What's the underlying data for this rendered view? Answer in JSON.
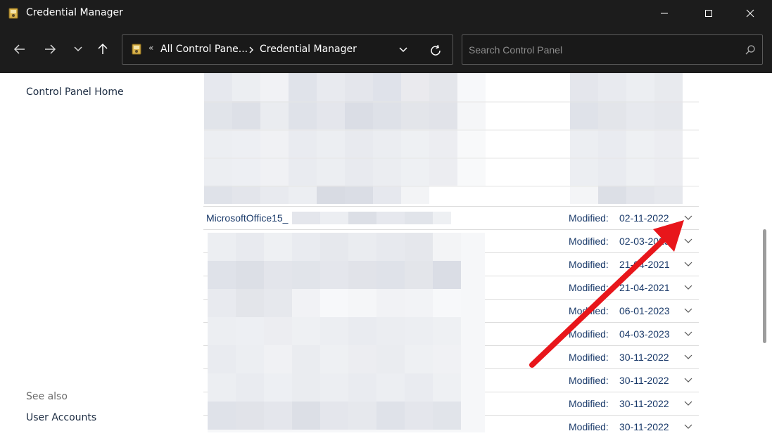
{
  "window": {
    "title": "Credential Manager",
    "minimize_icon": "minimize-icon",
    "maximize_icon": "maximize-icon",
    "close_icon": "close-icon"
  },
  "nav": {
    "back_icon": "arrow-left-icon",
    "forward_icon": "arrow-right-icon",
    "recent_icon": "chevron-down-icon",
    "up_icon": "arrow-up-icon"
  },
  "address": {
    "overflow_chevrons": "«",
    "crumb1": "All Control Pane...",
    "crumb2": "Credential Manager",
    "dropdown_icon": "chevron-down-icon",
    "refresh_icon": "refresh-icon"
  },
  "search": {
    "placeholder": "Search Control Panel",
    "value": "",
    "icon": "search-icon"
  },
  "sidebar": {
    "home_link": "Control Panel Home",
    "see_also": "See also",
    "links": [
      {
        "label": "User Accounts"
      }
    ]
  },
  "credentials": [
    {
      "name": "MicrosoftOffice15_",
      "modified_label": "Modified:",
      "date": "02-11-2022"
    },
    {
      "name": "",
      "modified_label": "Modified:",
      "date": "02-03-2023"
    },
    {
      "name": "",
      "modified_label": "Modified:",
      "date": "21-04-2021"
    },
    {
      "name": "",
      "modified_label": "Modified:",
      "date": "21-04-2021"
    },
    {
      "name": "",
      "modified_label": "Modified:",
      "date": "06-01-2023"
    },
    {
      "name": "",
      "modified_label": "Modified:",
      "date": "04-03-2023"
    },
    {
      "name": "",
      "modified_label": "Modified:",
      "date": "30-11-2022"
    },
    {
      "name": "",
      "modified_label": "Modified:",
      "date": "30-11-2022"
    },
    {
      "name": "",
      "modified_label": "Modified:",
      "date": "30-11-2022"
    },
    {
      "name": "",
      "modified_label": "Modified:",
      "date": "30-11-2022"
    }
  ],
  "colors": {
    "titlebar_bg": "#1c1c1c",
    "text_link": "#1a2a40",
    "credential_text": "#1a3a6a",
    "annotation_arrow": "#e8161b"
  }
}
